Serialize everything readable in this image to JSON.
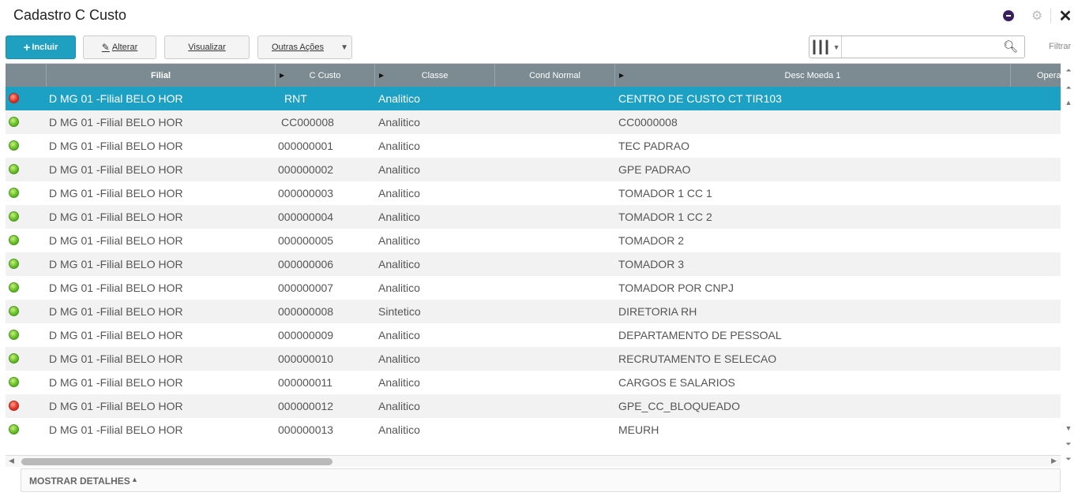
{
  "window": {
    "title": "Cadastro C Custo"
  },
  "toolbar": {
    "incluir_label": "Incluir",
    "alterar_label": "Alterar",
    "visualizar_label": "Visualizar",
    "outras_label": "Outras Ações",
    "filtrar_label": "Filtrar",
    "search_value": ""
  },
  "grid": {
    "columns": [
      "Filial",
      "C Custo",
      "Classe",
      "Cond Normal",
      "Desc Moeda 1",
      "Opera"
    ],
    "selected_row": 0,
    "rows": [
      {
        "status": "red",
        "filial": "D MG 01 -Filial BELO HOR",
        "ccusto": "RNT",
        "classe": "Analitico",
        "cond": "",
        "desc": "CENTRO DE CUSTO CT TIR103"
      },
      {
        "status": "green",
        "filial": "D MG 01 -Filial BELO HOR",
        "ccusto": "CC000008",
        "classe": "Analitico",
        "cond": "",
        "desc": "CC0000008"
      },
      {
        "status": "green",
        "filial": "D MG 01 -Filial BELO HOR",
        "ccusto": "000000001",
        "classe": "Analitico",
        "cond": "",
        "desc": "TEC PADRAO"
      },
      {
        "status": "green",
        "filial": "D MG 01 -Filial BELO HOR",
        "ccusto": "000000002",
        "classe": "Analitico",
        "cond": "",
        "desc": "GPE PADRAO"
      },
      {
        "status": "green",
        "filial": "D MG 01 -Filial BELO HOR",
        "ccusto": "000000003",
        "classe": "Analitico",
        "cond": "",
        "desc": "TOMADOR 1 CC 1"
      },
      {
        "status": "green",
        "filial": "D MG 01 -Filial BELO HOR",
        "ccusto": "000000004",
        "classe": "Analitico",
        "cond": "",
        "desc": "TOMADOR 1 CC 2"
      },
      {
        "status": "green",
        "filial": "D MG 01 -Filial BELO HOR",
        "ccusto": "000000005",
        "classe": "Analitico",
        "cond": "",
        "desc": "TOMADOR 2"
      },
      {
        "status": "green",
        "filial": "D MG 01 -Filial BELO HOR",
        "ccusto": "000000006",
        "classe": "Analitico",
        "cond": "",
        "desc": "TOMADOR 3"
      },
      {
        "status": "green",
        "filial": "D MG 01 -Filial BELO HOR",
        "ccusto": "000000007",
        "classe": "Analitico",
        "cond": "",
        "desc": "TOMADOR POR CNPJ"
      },
      {
        "status": "green",
        "filial": "D MG 01 -Filial BELO HOR",
        "ccusto": "000000008",
        "classe": "Sintetico",
        "cond": "",
        "desc": "DIRETORIA RH"
      },
      {
        "status": "green",
        "filial": "D MG 01 -Filial BELO HOR",
        "ccusto": "000000009",
        "classe": "Analitico",
        "cond": "",
        "desc": "DEPARTAMENTO DE PESSOAL"
      },
      {
        "status": "green",
        "filial": "D MG 01 -Filial BELO HOR",
        "ccusto": "000000010",
        "classe": "Analitico",
        "cond": "",
        "desc": "RECRUTAMENTO E SELECAO"
      },
      {
        "status": "green",
        "filial": "D MG 01 -Filial BELO HOR",
        "ccusto": "000000011",
        "classe": "Analitico",
        "cond": "",
        "desc": "CARGOS E SALARIOS"
      },
      {
        "status": "red",
        "filial": "D MG 01 -Filial BELO HOR",
        "ccusto": "000000012",
        "classe": "Analitico",
        "cond": "",
        "desc": "GPE_CC_BLOQUEADO"
      },
      {
        "status": "green",
        "filial": "D MG 01 -Filial BELO HOR",
        "ccusto": "000000013",
        "classe": "Analitico",
        "cond": "",
        "desc": "MEURH"
      }
    ]
  },
  "details": {
    "label": "MOSTRAR DETALHES"
  },
  "colors": {
    "primary": "#1fa0c1",
    "selected_row": "#1ca0c4",
    "header": "#7c8b92",
    "status_green": "#6bbf2a",
    "status_red": "#e23a2a"
  },
  "icons": {
    "title_bar": [
      "circle-minus-icon",
      "gear-icon",
      "close-icon"
    ],
    "toolbar": [
      "plus-icon",
      "pencil-icon",
      "caret-down-icon",
      "columns-icon",
      "search-icon"
    ]
  }
}
